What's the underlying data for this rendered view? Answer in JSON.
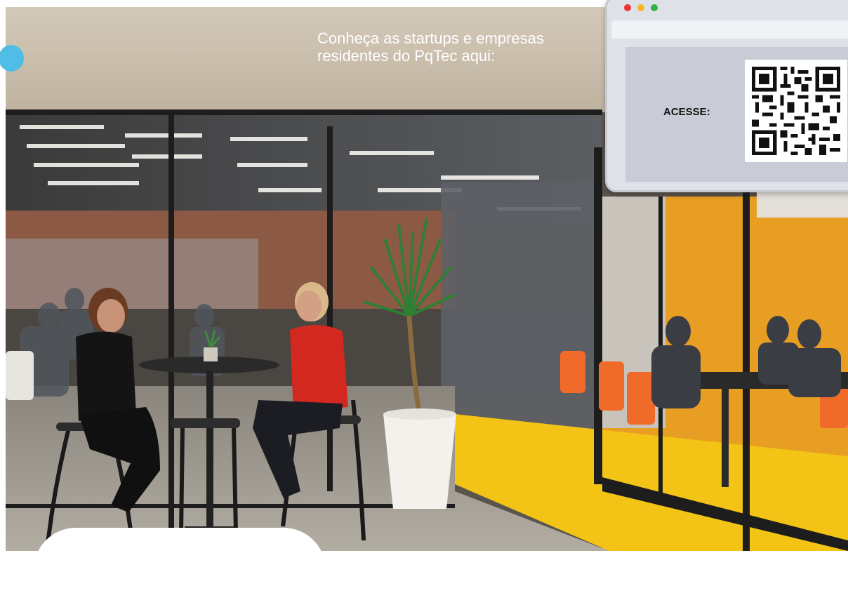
{
  "caption": {
    "line1": "Conheça as startups e empresas",
    "line2": "residentes do PqTec aqui:"
  },
  "qr_panel": {
    "label": "ACESSE:"
  },
  "colors": {
    "accent_blue": "#4fbde6",
    "traffic_red": "#f0313c",
    "traffic_yellow": "#f5b820",
    "traffic_green": "#2bb24c",
    "room_orange": "#f0a21a"
  },
  "icons": [
    "qr-code-icon",
    "window-close-dot",
    "window-minimize-dot",
    "window-maximize-dot"
  ]
}
